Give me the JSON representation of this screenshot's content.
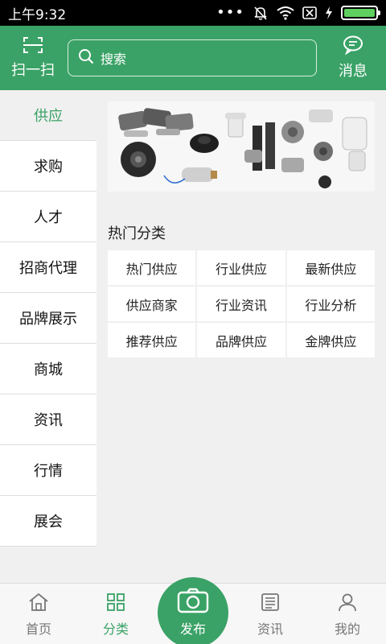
{
  "status_bar": {
    "time": "上午9:32",
    "dots": "•••"
  },
  "header": {
    "scan_label": "扫一扫",
    "search_placeholder": "搜索",
    "message_label": "消息"
  },
  "sidebar": {
    "items": [
      {
        "label": "供应",
        "active": true
      },
      {
        "label": "求购"
      },
      {
        "label": "人才"
      },
      {
        "label": "招商代理"
      },
      {
        "label": "品牌展示"
      },
      {
        "label": "商城"
      },
      {
        "label": "资讯"
      },
      {
        "label": "行情"
      },
      {
        "label": "展会"
      }
    ]
  },
  "main": {
    "section_title": "热门分类",
    "categories": [
      "热门供应",
      "行业供应",
      "最新供应",
      "供应商家",
      "行业资讯",
      "行业分析",
      "推荐供应",
      "品牌供应",
      "金牌供应"
    ]
  },
  "tabbar": {
    "home": "首页",
    "category": "分类",
    "publish": "发布",
    "news": "资讯",
    "mine": "我的"
  },
  "colors": {
    "accent": "#3aa266",
    "inactive": "#777777"
  }
}
